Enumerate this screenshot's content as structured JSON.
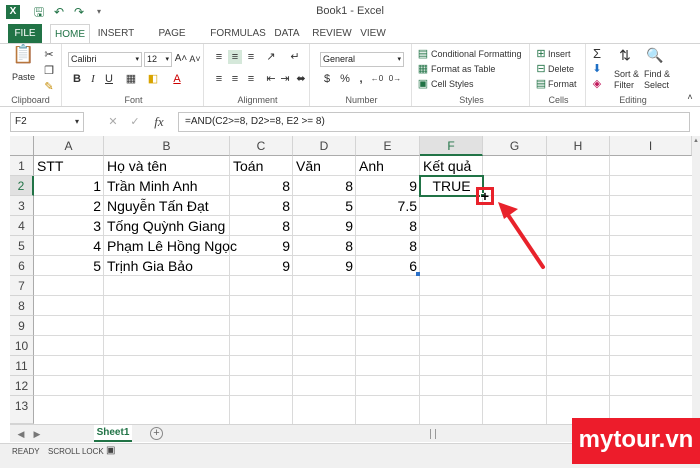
{
  "window": {
    "title": "Book1 - Excel",
    "accent": "#217346",
    "annotation_color": "#e8222b"
  },
  "quick_access": {
    "icons": [
      "excel-logo-icon",
      "save-icon",
      "undo-icon",
      "redo-icon",
      "customize-icon"
    ]
  },
  "ribbon_tabs": [
    "FILE",
    "HOME",
    "INSERT",
    "PAGE LAYOUT",
    "FORMULAS",
    "DATA",
    "REVIEW",
    "VIEW"
  ],
  "ribbon": {
    "clipboard": {
      "label": "Clipboard",
      "paste": "Paste"
    },
    "font": {
      "label": "Font",
      "family": "Calibri",
      "size": "12"
    },
    "alignment": {
      "label": "Alignment"
    },
    "number": {
      "label": "Number",
      "format": "General",
      "currency": "$",
      "percent": "%",
      "comma": ","
    },
    "styles": {
      "label": "Styles",
      "conditional_formatting": "Conditional Formatting",
      "format_as_table": "Format as Table",
      "cell_styles": "Cell Styles"
    },
    "cells": {
      "label": "Cells",
      "insert": "Insert",
      "delete": "Delete",
      "format": "Format"
    },
    "editing": {
      "label": "Editing",
      "sort_filter": "Sort &",
      "sort_filter_2": "Filter",
      "find_select": "Find &",
      "find_select_2": "Select"
    }
  },
  "formula_bar": {
    "name_box": "F2",
    "formula": "=AND(C2>=8, D2>=8, E2 >= 8)"
  },
  "columns": [
    "A",
    "B",
    "C",
    "D",
    "E",
    "F",
    "G",
    "H",
    "I"
  ],
  "rows": [
    "1",
    "2",
    "3",
    "4",
    "5",
    "6",
    "7",
    "8",
    "9",
    "10",
    "11",
    "12",
    "13"
  ],
  "headers": {
    "a": "STT",
    "b": "Họ và tên",
    "c": "Toán",
    "d": "Văn",
    "e": "Anh",
    "f": "Kết quả"
  },
  "data_rows": [
    {
      "stt": "1",
      "name": "Trần Minh Anh",
      "toan": "8",
      "van": "8",
      "anh": "9",
      "ket_qua": "TRUE"
    },
    {
      "stt": "2",
      "name": "Nguyễn Tấn Đạt",
      "toan": "8",
      "van": "5",
      "anh": "7.5",
      "ket_qua": ""
    },
    {
      "stt": "3",
      "name": "Tống Quỳnh Giang",
      "toan": "8",
      "van": "9",
      "anh": "8",
      "ket_qua": ""
    },
    {
      "stt": "4",
      "name": "Phạm Lê Hồng Ngọc",
      "toan": "9",
      "van": "8",
      "anh": "8",
      "ket_qua": ""
    },
    {
      "stt": "5",
      "name": "Trịnh Gia Bảo",
      "toan": "9",
      "van": "9",
      "anh": "6",
      "ket_qua": ""
    }
  ],
  "sheet_tab": "Sheet1",
  "status_bar": {
    "ready": "READY",
    "scroll_lock": "SCROLL LOCK"
  },
  "watermark": "mytour.vn"
}
